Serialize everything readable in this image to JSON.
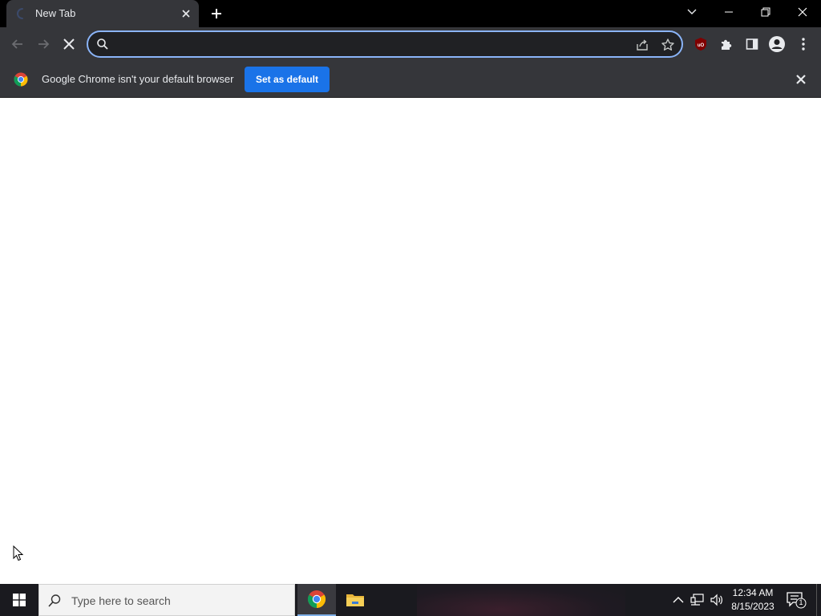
{
  "browser": {
    "tab": {
      "title": "New Tab",
      "spinner_icon": "loading-spinner-icon",
      "close_icon": "close-icon"
    },
    "new_tab_icon": "plus-icon",
    "window_controls": [
      "chevron-down-icon",
      "minimize-icon",
      "restore-icon",
      "close-icon"
    ],
    "toolbar": {
      "back_icon": "arrow-left-icon",
      "forward_icon": "arrow-right-icon",
      "stop_icon": "close-icon",
      "omnibox": {
        "value": "",
        "placeholder": ""
      },
      "omnibox_icons": [
        "search-icon",
        "share-icon",
        "star-icon"
      ],
      "extensions": [
        "ublock-icon",
        "puzzle-icon",
        "sidepanel-icon",
        "profile-icon",
        "kebab-menu-icon"
      ]
    },
    "infobar": {
      "message": "Google Chrome isn't your default browser",
      "button_label": "Set as default",
      "close_icon": "close-icon"
    }
  },
  "taskbar": {
    "search_placeholder": "Type here to search",
    "apps": [
      "chrome-icon",
      "file-explorer-icon"
    ],
    "clock": {
      "time": "12:34 AM",
      "date": "8/15/2023"
    },
    "notification_count": "1"
  },
  "colors": {
    "accent_blue": "#1a73e8",
    "focus_ring": "#8ab4f8",
    "toolbar_bg": "#35363a",
    "tabstrip_bg": "#000000",
    "omnibox_bg": "#202124",
    "taskbar_bg": "#1a1a1f"
  }
}
